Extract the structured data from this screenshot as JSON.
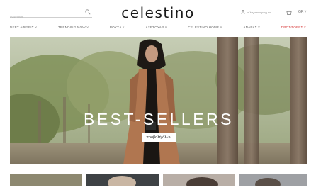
{
  "search": {
    "placeholder": "αναζήτηση"
  },
  "logo": {
    "text": "celestino"
  },
  "header": {
    "account_label": "ο λογαριασμός μου",
    "language": "GR"
  },
  "nav": {
    "items": [
      {
        "label": "ΝΕΕΣ ΑΦΙΞΕΙΣ ˅"
      },
      {
        "label": "TRENDING NOW ˅"
      },
      {
        "label": "ΡΟΥΧΑ ˅"
      },
      {
        "label": "ΑΞΕΣΟΥΑΡ ˅"
      },
      {
        "label": "CELESTINO HOME ˅"
      },
      {
        "label": "ΑΝΔΡΑΣ ˅"
      },
      {
        "label": "ΠΡΟΣΦΟΡΕΣ ˅"
      }
    ]
  },
  "hero": {
    "title": "BEST-SELLERS",
    "button_label": "προβολή όλων"
  },
  "colors": {
    "promo": "#d63a3a",
    "hero_text": "#ffffff"
  }
}
